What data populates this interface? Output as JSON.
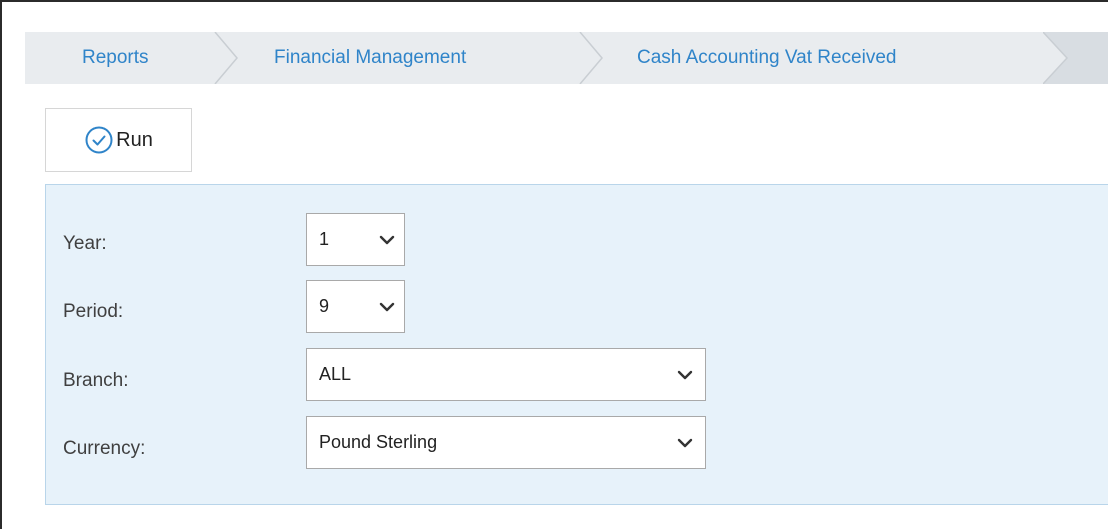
{
  "breadcrumb": {
    "items": [
      {
        "label": "Reports"
      },
      {
        "label": "Financial Management"
      },
      {
        "label": "Cash Accounting Vat Received"
      }
    ]
  },
  "toolbar": {
    "run_label": "Run"
  },
  "filters": {
    "year": {
      "label": "Year:",
      "value": "1"
    },
    "period": {
      "label": "Period:",
      "value": "9"
    },
    "branch": {
      "label": "Branch:",
      "value": "ALL"
    },
    "currency": {
      "label": "Currency:",
      "value": "Pound Sterling"
    }
  },
  "colors": {
    "accent": "#2f84c9",
    "breadcrumb_bg": "#e9ecef",
    "panel_bg": "#e7f2fa",
    "panel_border": "#b9d5ea"
  },
  "icons": {
    "run": "check-circle-icon",
    "dropdown": "chevron-down-icon",
    "separator": "chevron-separator-icon"
  }
}
